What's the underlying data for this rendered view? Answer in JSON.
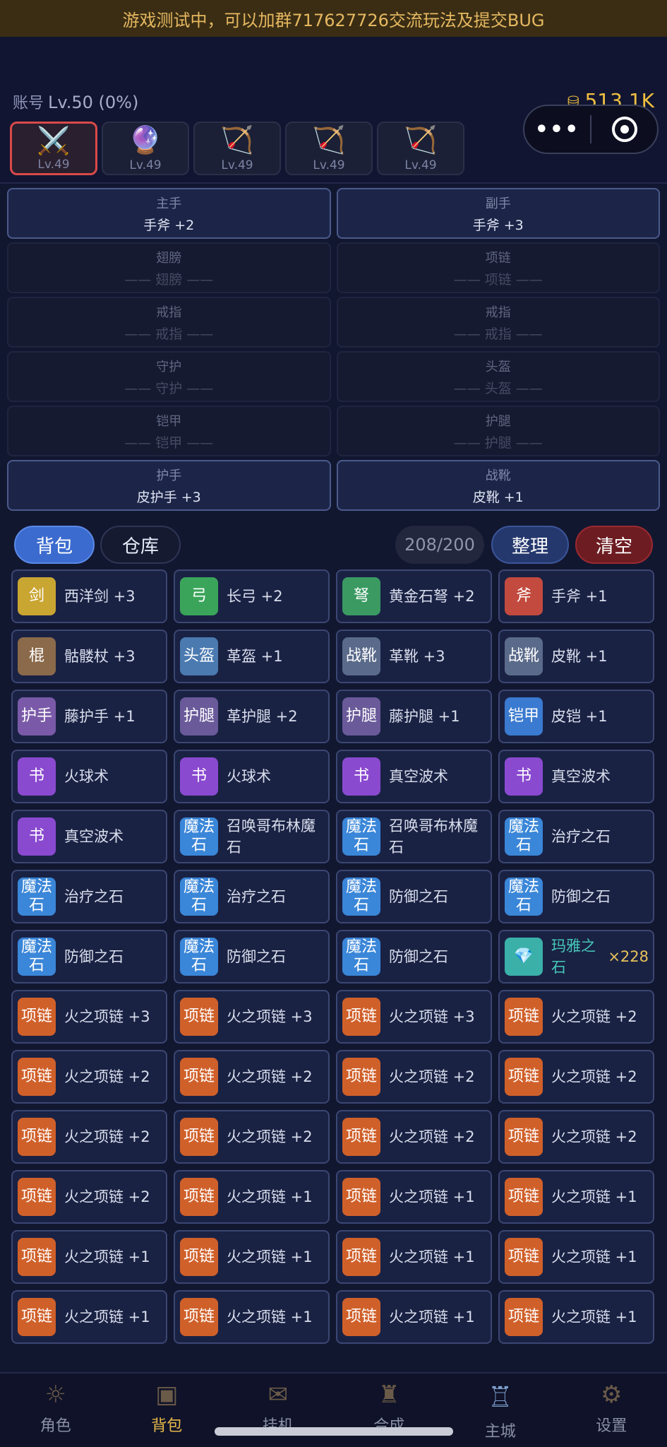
{
  "banner": {
    "text": "游戏测试中，可以加群717627726交流玩法及提交BUG"
  },
  "account": {
    "label": "账号",
    "level": "Lv.50 (0%)"
  },
  "gold": {
    "value": "513.1K",
    "icon": "gold-pile-icon"
  },
  "capsule": {
    "more": "•••",
    "close_icon": "target-icon"
  },
  "characters": [
    {
      "icon": "crossed-swords-icon",
      "glyph": "⚔️",
      "level": "Lv.49",
      "active": true
    },
    {
      "icon": "crystal-ball-icon",
      "glyph": "🔮",
      "level": "Lv.49",
      "active": false
    },
    {
      "icon": "bow-icon",
      "glyph": "🏹",
      "level": "Lv.49",
      "active": false
    },
    {
      "icon": "bow-icon",
      "glyph": "🏹",
      "level": "Lv.49",
      "active": false
    },
    {
      "icon": "bow-icon",
      "glyph": "🏹",
      "level": "Lv.49",
      "active": false
    }
  ],
  "equipment": [
    {
      "slot": "主手",
      "value": "手斧 +2",
      "empty": false
    },
    {
      "slot": "副手",
      "value": "手斧 +3",
      "empty": false
    },
    {
      "slot": "翅膀",
      "value": "—— 翅膀 ——",
      "empty": true
    },
    {
      "slot": "项链",
      "value": "—— 项链 ——",
      "empty": true
    },
    {
      "slot": "戒指",
      "value": "—— 戒指 ——",
      "empty": true
    },
    {
      "slot": "戒指",
      "value": "—— 戒指 ——",
      "empty": true
    },
    {
      "slot": "守护",
      "value": "—— 守护 ——",
      "empty": true
    },
    {
      "slot": "头盔",
      "value": "—— 头盔 ——",
      "empty": true
    },
    {
      "slot": "铠甲",
      "value": "—— 铠甲 ——",
      "empty": true
    },
    {
      "slot": "护腿",
      "value": "—— 护腿 ——",
      "empty": true
    },
    {
      "slot": "护手",
      "value": "皮护手 +3",
      "empty": false
    },
    {
      "slot": "战靴",
      "value": "皮靴 +1",
      "empty": false
    }
  ],
  "tabs": {
    "bag": "背包",
    "storage": "仓库"
  },
  "capacity": "208/200",
  "buttons": {
    "sort": "整理",
    "clear": "清空"
  },
  "colors": {
    "sword": "#c9a532",
    "bow": "#3aa55a",
    "crossbow": "#3a9a62",
    "axe": "#c24a3e",
    "staff": "#8a6a4a",
    "helmet": "#4a7ab0",
    "boots": "#5a6a8a",
    "gloves": "#7a5aa8",
    "legs": "#6a5a9a",
    "armor": "#3a7ad0",
    "book": "#8a4ad0",
    "stone": "#3a86d8",
    "gem": "#3ab0a8",
    "necklace": "#d0602a"
  },
  "inventory": [
    {
      "badge": "剑",
      "color": "sword",
      "name": "西洋剑 +3"
    },
    {
      "badge": "弓",
      "color": "bow",
      "name": "长弓 +2"
    },
    {
      "badge": "弩",
      "color": "crossbow",
      "name": "黄金石弩 +2"
    },
    {
      "badge": "斧",
      "color": "axe",
      "name": "手斧 +1"
    },
    {
      "badge": "棍",
      "color": "staff",
      "name": "骷髅杖 +3"
    },
    {
      "badge": "头盔",
      "color": "helmet",
      "name": "革盔 +1"
    },
    {
      "badge": "战靴",
      "color": "boots",
      "name": "革靴 +3"
    },
    {
      "badge": "战靴",
      "color": "boots",
      "name": "皮靴 +1"
    },
    {
      "badge": "护手",
      "color": "gloves",
      "name": "藤护手 +1"
    },
    {
      "badge": "护腿",
      "color": "legs",
      "name": "革护腿 +2"
    },
    {
      "badge": "护腿",
      "color": "legs",
      "name": "藤护腿 +1"
    },
    {
      "badge": "铠甲",
      "color": "armor",
      "name": "皮铠 +1"
    },
    {
      "badge": "书",
      "color": "book",
      "name": "火球术"
    },
    {
      "badge": "书",
      "color": "book",
      "name": "火球术"
    },
    {
      "badge": "书",
      "color": "book",
      "name": "真空波术"
    },
    {
      "badge": "书",
      "color": "book",
      "name": "真空波术"
    },
    {
      "badge": "书",
      "color": "book",
      "name": "真空波术"
    },
    {
      "badge": "魔法石",
      "color": "stone",
      "name": "召唤哥布林魔石"
    },
    {
      "badge": "魔法石",
      "color": "stone",
      "name": "召唤哥布林魔石"
    },
    {
      "badge": "魔法石",
      "color": "stone",
      "name": "治疗之石"
    },
    {
      "badge": "魔法石",
      "color": "stone",
      "name": "治疗之石"
    },
    {
      "badge": "魔法石",
      "color": "stone",
      "name": "治疗之石"
    },
    {
      "badge": "魔法石",
      "color": "stone",
      "name": "防御之石"
    },
    {
      "badge": "魔法石",
      "color": "stone",
      "name": "防御之石"
    },
    {
      "badge": "魔法石",
      "color": "stone",
      "name": "防御之石"
    },
    {
      "badge": "魔法石",
      "color": "stone",
      "name": "防御之石"
    },
    {
      "badge": "魔法石",
      "color": "stone",
      "name": "防御之石"
    },
    {
      "badge": "💎",
      "color": "gem",
      "name": "玛雅之石",
      "qty": "×228",
      "gem": true
    },
    {
      "badge": "项链",
      "color": "necklace",
      "name": "火之项链 +3"
    },
    {
      "badge": "项链",
      "color": "necklace",
      "name": "火之项链 +3"
    },
    {
      "badge": "项链",
      "color": "necklace",
      "name": "火之项链 +3"
    },
    {
      "badge": "项链",
      "color": "necklace",
      "name": "火之项链 +2"
    },
    {
      "badge": "项链",
      "color": "necklace",
      "name": "火之项链 +2"
    },
    {
      "badge": "项链",
      "color": "necklace",
      "name": "火之项链 +2"
    },
    {
      "badge": "项链",
      "color": "necklace",
      "name": "火之项链 +2"
    },
    {
      "badge": "项链",
      "color": "necklace",
      "name": "火之项链 +2"
    },
    {
      "badge": "项链",
      "color": "necklace",
      "name": "火之项链 +2"
    },
    {
      "badge": "项链",
      "color": "necklace",
      "name": "火之项链 +2"
    },
    {
      "badge": "项链",
      "color": "necklace",
      "name": "火之项链 +2"
    },
    {
      "badge": "项链",
      "color": "necklace",
      "name": "火之项链 +2"
    },
    {
      "badge": "项链",
      "color": "necklace",
      "name": "火之项链 +2"
    },
    {
      "badge": "项链",
      "color": "necklace",
      "name": "火之项链 +1"
    },
    {
      "badge": "项链",
      "color": "necklace",
      "name": "火之项链 +1"
    },
    {
      "badge": "项链",
      "color": "necklace",
      "name": "火之项链 +1"
    },
    {
      "badge": "项链",
      "color": "necklace",
      "name": "火之项链 +1"
    },
    {
      "badge": "项链",
      "color": "necklace",
      "name": "火之项链 +1"
    },
    {
      "badge": "项链",
      "color": "necklace",
      "name": "火之项链 +1"
    },
    {
      "badge": "项链",
      "color": "necklace",
      "name": "火之项链 +1"
    },
    {
      "badge": "项链",
      "color": "necklace",
      "name": "火之项链 +1"
    },
    {
      "badge": "项链",
      "color": "necklace",
      "name": "火之项链 +1"
    },
    {
      "badge": "项链",
      "color": "necklace",
      "name": "火之项链 +1"
    },
    {
      "badge": "项链",
      "color": "necklace",
      "name": "火之项链 +1"
    },
    {
      "badge": "项链",
      "color": "necklace",
      "name": "火之项链 +1"
    },
    {
      "badge": "项链",
      "color": "necklace",
      "name": "火之项链 +1"
    },
    {
      "badge": "项链",
      "color": "necklace",
      "name": "火之项链 +1"
    },
    {
      "badge": "项链",
      "color": "necklace",
      "name": "火之项链 +1"
    }
  ],
  "nav": [
    {
      "label": "角色",
      "icon": "character-icon",
      "glyph": "☼"
    },
    {
      "label": "背包",
      "icon": "backpack-icon",
      "glyph": "▣",
      "active": true
    },
    {
      "label": "挂机",
      "icon": "scroll-icon",
      "glyph": "✉"
    },
    {
      "label": "合成",
      "icon": "forge-icon",
      "glyph": "♜"
    },
    {
      "label": "主城",
      "icon": "castle-icon",
      "glyph": "♖",
      "main": true
    },
    {
      "label": "设置",
      "icon": "gear-icon",
      "glyph": "⚙"
    }
  ]
}
